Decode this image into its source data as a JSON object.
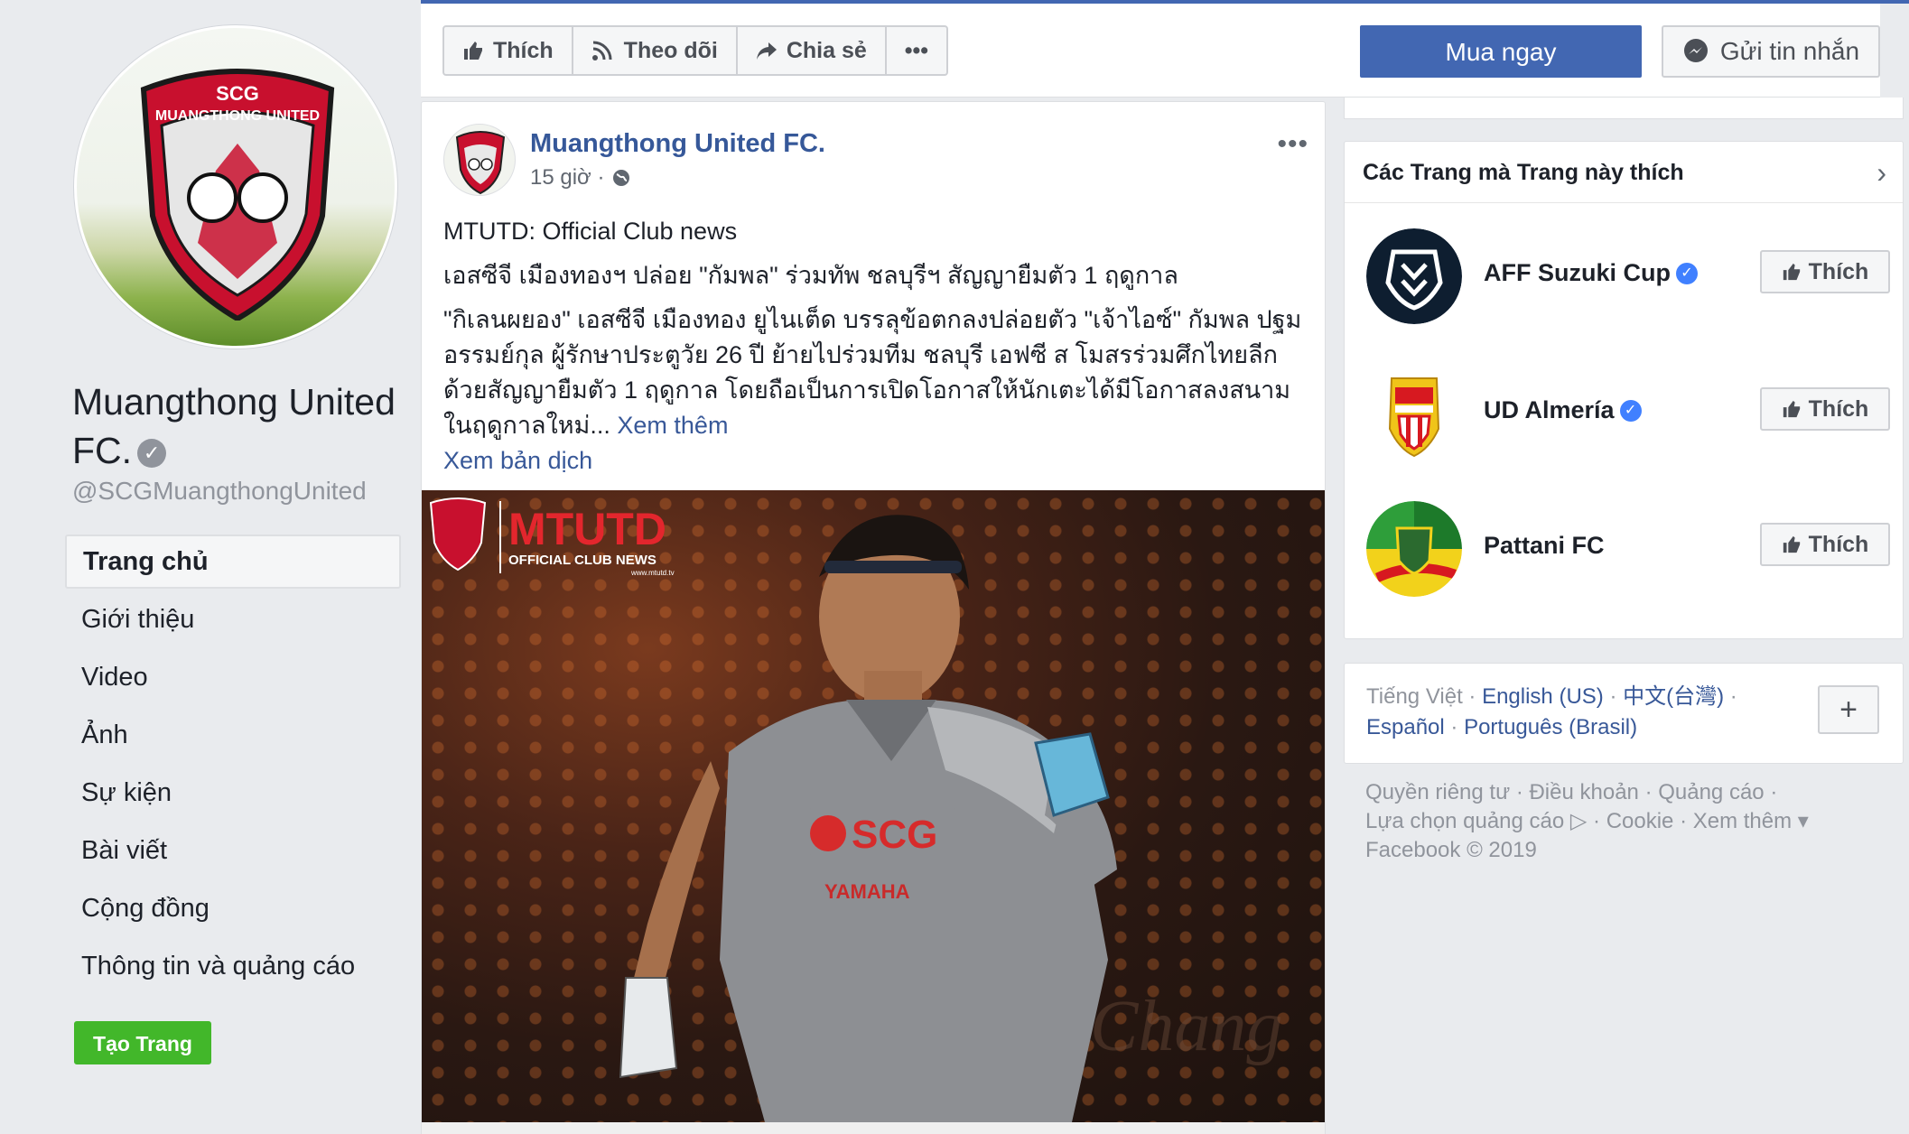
{
  "page": {
    "name": "Muangthong United FC.",
    "handle": "@SCGMuangthongUnited"
  },
  "nav": {
    "items": [
      {
        "label": "Trang chủ",
        "active": true
      },
      {
        "label": "Giới thiệu"
      },
      {
        "label": "Video"
      },
      {
        "label": "Ảnh"
      },
      {
        "label": "Sự kiện"
      },
      {
        "label": "Bài viết"
      },
      {
        "label": "Cộng đồng"
      },
      {
        "label": "Thông tin và quảng cáo"
      }
    ],
    "create_page_label": "Tạo Trang"
  },
  "actionbar": {
    "like": "Thích",
    "follow": "Theo dõi",
    "share": "Chia sẻ",
    "more": "•••",
    "buy": "Mua ngay",
    "message": "Gửi tin nhắn"
  },
  "post": {
    "author": "Muangthong United FC.",
    "time": "15 giờ ·",
    "more": "•••",
    "line1": "MTUTD: Official Club news",
    "line2": "เอสซีจี เมืองทองฯ ปล่อย \"กัมพล\" ร่วมทัพ ชลบุรีฯ สัญญายืมตัว 1 ฤดูกาล",
    "line3": "\"กิเลนผยอง\" เอสซีจี เมืองทอง ยูไนเต็ด บรรลุข้อตกลงปล่อยตัว \"เจ้าไอซ์\" กัมพล ปฐมอรรมย์กุล ผู้รักษาประตูวัย 26 ปี ย้ายไปร่วมทีม ชลบุรี เอฟซี ส โมสรร่วมศึกไทยลีก ด้วยสัญญายืมตัว 1 ฤดูกาล โดยถือเป็นการเปิดโอกาสให้นักเตะได้มีโอกาสลงสนามในฤดูกาลใหม่...",
    "see_more": "Xem thêm",
    "see_translation": "Xem bản dịch",
    "image_logo_text": "MTUTD",
    "image_sub_text": "OFFICIAL CLUB NEWS",
    "image_url_text": "www.mtutd.tv",
    "jersey_sponsor": "SCG",
    "jersey_sponsor2": "YAMAHA"
  },
  "liked_pages": {
    "title": "Các Trang mà Trang này thích",
    "items": [
      {
        "name": "AFF Suzuki Cup",
        "verified": true,
        "button": "Thích"
      },
      {
        "name": "UD Almería",
        "verified": true,
        "button": "Thích"
      },
      {
        "name": "Pattani FC",
        "verified": false,
        "button": "Thích"
      }
    ]
  },
  "languages": {
    "current": "Tiếng Việt",
    "options": [
      "English (US)",
      "中文(台灣)",
      "Español",
      "Português (Brasil)"
    ],
    "add": "+"
  },
  "footer": {
    "line1": "Quyền riêng tư · Điều khoản · Quảng cáo ·",
    "line2": "Lựa chọn quảng cáo ▷ · Cookie · Xem thêm ▾",
    "line3": "Facebook © 2019"
  },
  "colors": {
    "fb_blue": "#4267b2",
    "link": "#385898",
    "green": "#42b72a",
    "verified": "#4080ff"
  }
}
